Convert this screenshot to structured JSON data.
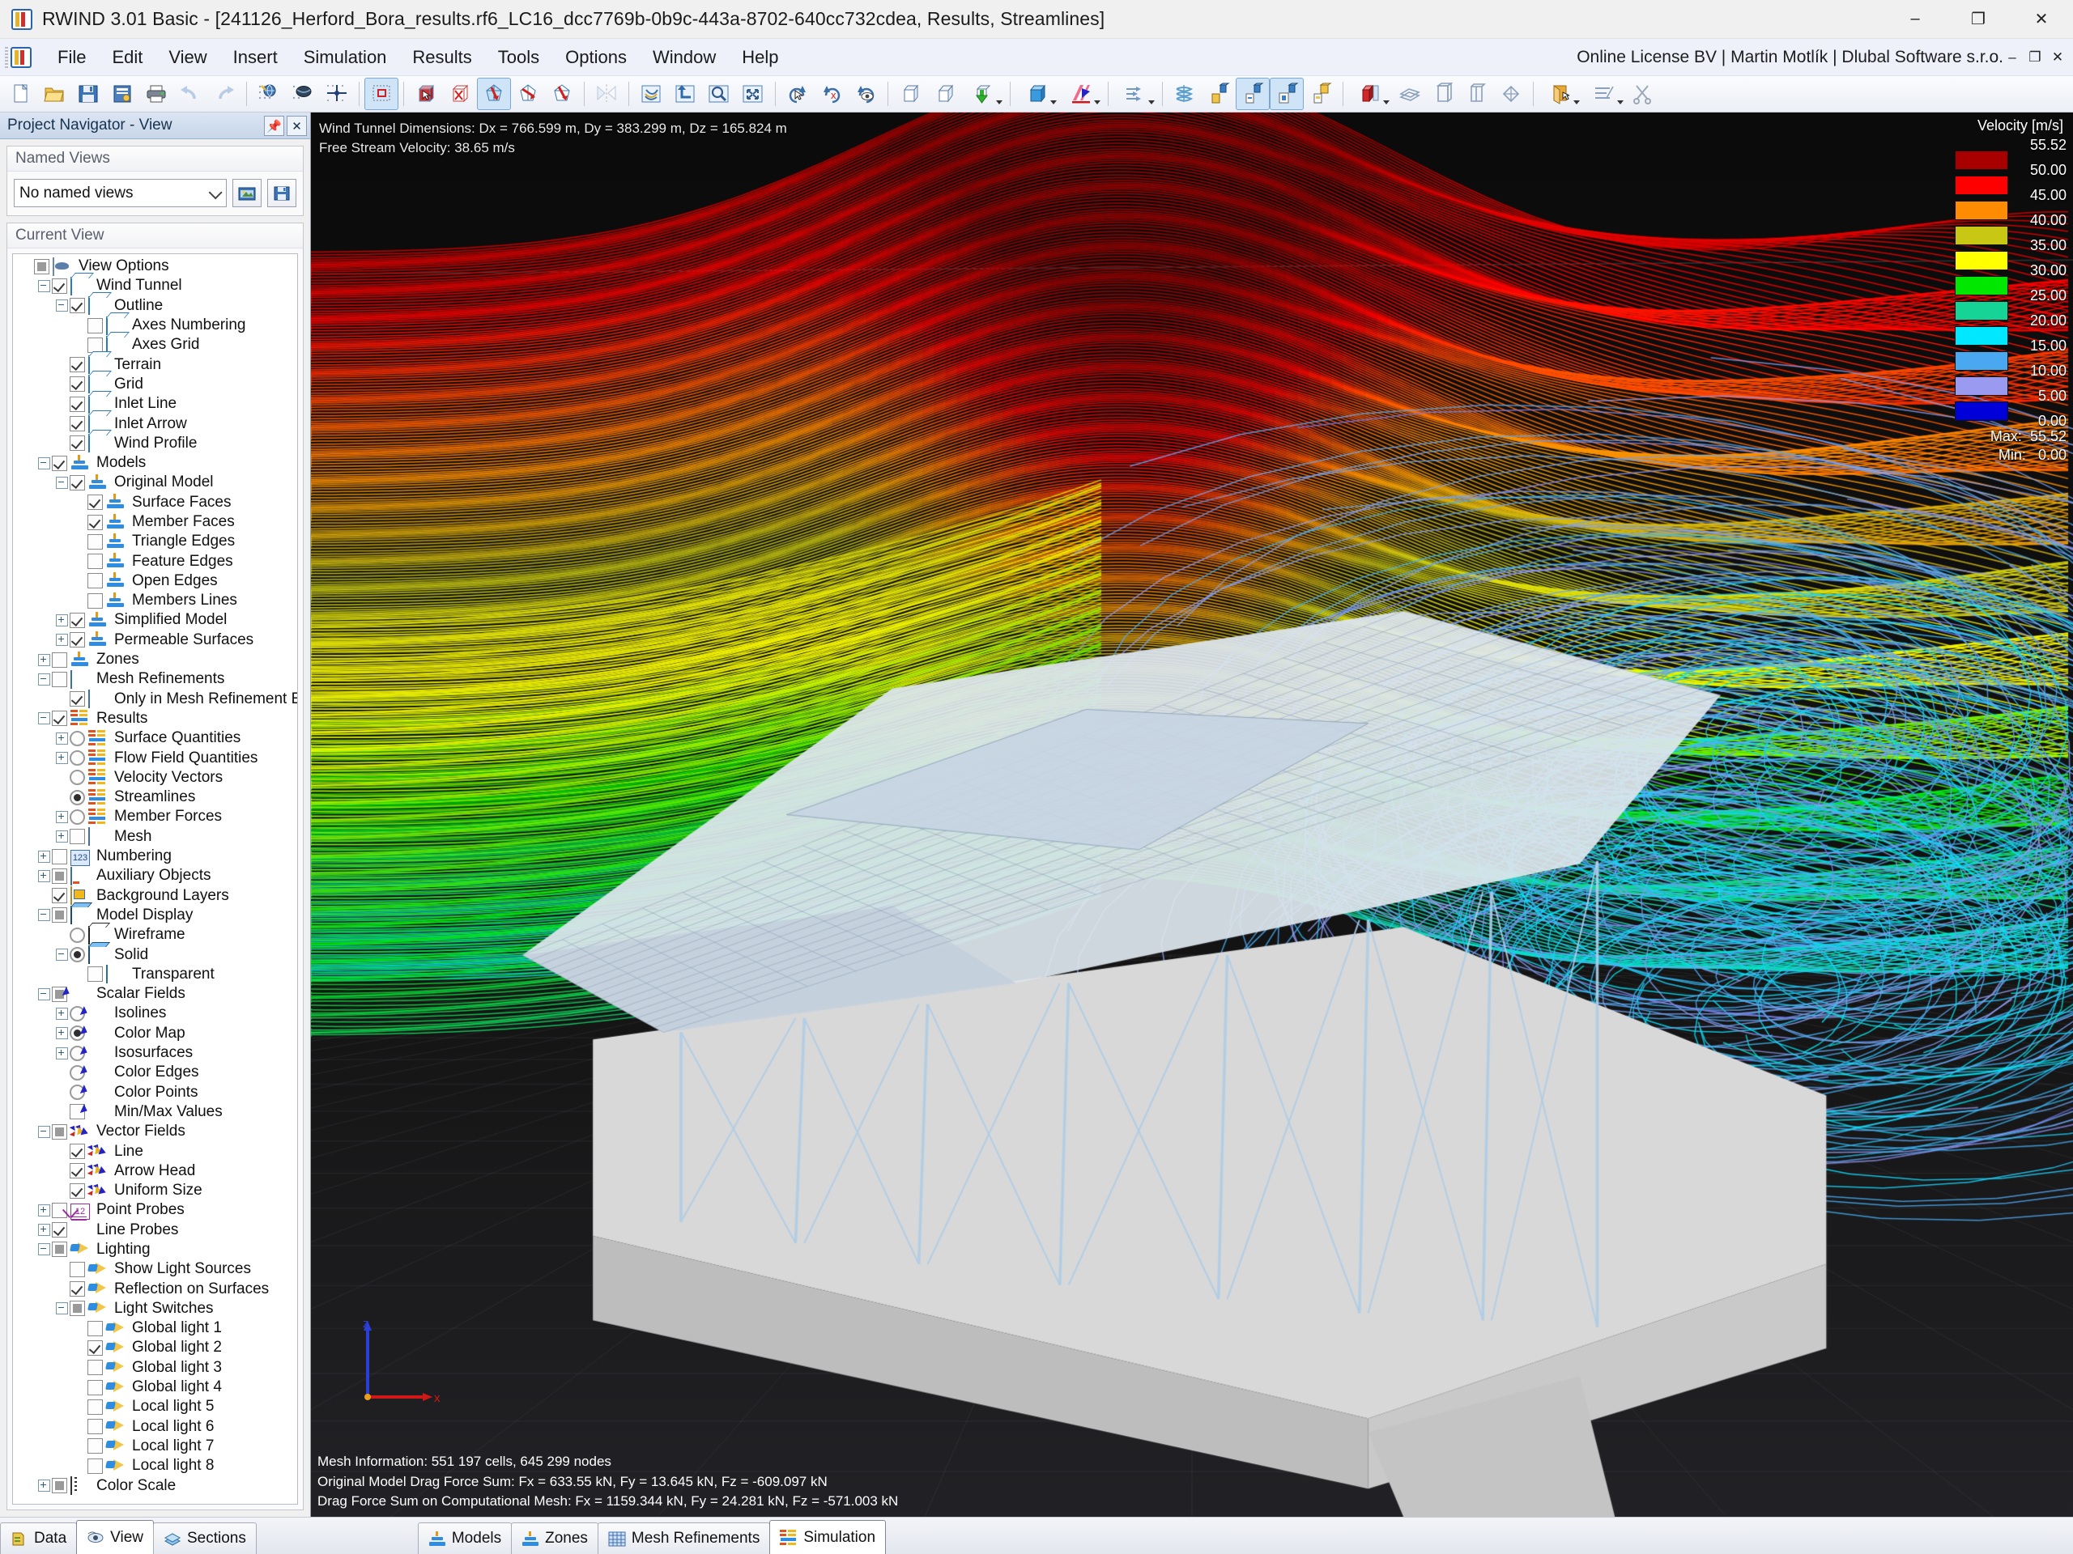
{
  "window": {
    "app_icon": "rwind-icon",
    "title": "RWIND 3.01 Basic - [241126_Herford_Bora_results.rf6_LC16_dcc7769b-0b9c-443a-8702-640cc732cdea, Results, Streamlines]",
    "minimize": "–",
    "maximize": "❐",
    "close": "✕"
  },
  "menubar": {
    "items": [
      "File",
      "Edit",
      "View",
      "Insert",
      "Simulation",
      "Results",
      "Tools",
      "Options",
      "Window",
      "Help"
    ],
    "license": "Online License BV | Martin Motlík | Dlubal Software s.r.o.",
    "mdi_restore": "❐",
    "mdi_close": "✕"
  },
  "toolbar": {
    "buttons": [
      {
        "name": "new-file",
        "icon": "page"
      },
      {
        "name": "open-file",
        "icon": "folder"
      },
      {
        "name": "save-file",
        "icon": "floppy"
      },
      {
        "name": "project-details",
        "icon": "form"
      },
      {
        "name": "print",
        "icon": "printer"
      },
      {
        "name": "undo",
        "icon": "undo",
        "disabled": true
      },
      {
        "name": "redo",
        "icon": "redo",
        "disabled": true
      },
      {
        "name": "render-quality",
        "icon": "dots-globe"
      },
      {
        "name": "visual-settings",
        "icon": "globe-dark"
      },
      {
        "name": "snap-point",
        "icon": "crosshair"
      },
      {
        "name": "selection-box",
        "icon": "dotted-box",
        "active": true
      },
      {
        "name": "select-objects",
        "icon": "cube-arrow"
      },
      {
        "name": "deselect-objects",
        "icon": "cube-x"
      },
      {
        "name": "rotate-view-x",
        "icon": "rot-x",
        "active": true
      },
      {
        "name": "rotate-view-y",
        "icon": "rot-y"
      },
      {
        "name": "rotate-view-z",
        "icon": "rot-z"
      },
      {
        "name": "mirror",
        "icon": "mirror",
        "disabled": true
      },
      {
        "name": "refresh-view",
        "icon": "refresh-blue"
      },
      {
        "name": "previous-view",
        "icon": "back-arrow"
      },
      {
        "name": "zoom-window",
        "icon": "magnifier"
      },
      {
        "name": "zoom-all",
        "icon": "fit-screen"
      },
      {
        "name": "rotate-left",
        "icon": "rot-left"
      },
      {
        "name": "rotate-right",
        "icon": "rot-right"
      },
      {
        "name": "view-rotate-eye",
        "icon": "rot-eye"
      },
      {
        "name": "view-isometric",
        "icon": "cube-iso"
      },
      {
        "name": "view-perspective",
        "icon": "cube-persp"
      },
      {
        "name": "wind-direction",
        "icon": "green-arrow",
        "caret": true
      },
      {
        "name": "model-display",
        "icon": "cube-blue",
        "caret": true
      },
      {
        "name": "scalar-field",
        "icon": "scalar",
        "caret": true
      },
      {
        "name": "streamline-settings",
        "icon": "flow-arrows",
        "caret": true
      },
      {
        "name": "isosurface",
        "icon": "iso-wave"
      },
      {
        "name": "result-diagram-1",
        "icon": "res-1"
      },
      {
        "name": "result-diagram-2",
        "icon": "res-2",
        "active": true
      },
      {
        "name": "result-diagram-3",
        "icon": "res-3",
        "active": true
      },
      {
        "name": "result-diagram-4",
        "icon": "res-4"
      },
      {
        "name": "section-cut",
        "icon": "cut-red",
        "caret": true
      },
      {
        "name": "clip-plane-1",
        "icon": "plane-1"
      },
      {
        "name": "clip-plane-2",
        "icon": "plane-2"
      },
      {
        "name": "clip-plane-3",
        "icon": "plane-3"
      },
      {
        "name": "clip-plane-4",
        "icon": "plane-4"
      },
      {
        "name": "render-mode",
        "icon": "paper-orange",
        "caret": true
      },
      {
        "name": "scissors-settings",
        "icon": "scissors-lines",
        "caret": true
      },
      {
        "name": "scissors",
        "icon": "scissors"
      }
    ]
  },
  "navigator": {
    "title": "Project Navigator - View",
    "pin_icon": "pin-icon",
    "close_icon": "close-icon",
    "named_views": {
      "header": "Named Views",
      "selected": "No named views",
      "open_button_icon": "open-view-icon",
      "save_button_icon": "save-view-icon"
    },
    "current_view": {
      "header": "Current View",
      "tree": [
        {
          "label": "View Options",
          "depth": 0,
          "state": "part",
          "ctl": "check",
          "exp": "none",
          "icon": "view"
        },
        {
          "label": "Wind Tunnel",
          "depth": 1,
          "state": "on",
          "ctl": "check",
          "exp": "minus",
          "icon": "cube"
        },
        {
          "label": "Outline",
          "depth": 2,
          "state": "on",
          "ctl": "check",
          "exp": "minus",
          "icon": "cube"
        },
        {
          "label": "Axes Numbering",
          "depth": 3,
          "state": "off",
          "ctl": "check",
          "exp": "none",
          "icon": "cube"
        },
        {
          "label": "Axes Grid",
          "depth": 3,
          "state": "off",
          "ctl": "check",
          "exp": "none",
          "icon": "cube"
        },
        {
          "label": "Terrain",
          "depth": 2,
          "state": "on",
          "ctl": "check",
          "exp": "none",
          "icon": "cube"
        },
        {
          "label": "Grid",
          "depth": 2,
          "state": "on",
          "ctl": "check",
          "exp": "none",
          "icon": "cube"
        },
        {
          "label": "Inlet Line",
          "depth": 2,
          "state": "on",
          "ctl": "check",
          "exp": "none",
          "icon": "cube"
        },
        {
          "label": "Inlet Arrow",
          "depth": 2,
          "state": "on",
          "ctl": "check",
          "exp": "none",
          "icon": "cube"
        },
        {
          "label": "Wind Profile",
          "depth": 2,
          "state": "on",
          "ctl": "check",
          "exp": "none",
          "icon": "cube"
        },
        {
          "label": "Models",
          "depth": 1,
          "state": "on",
          "ctl": "check",
          "exp": "minus",
          "icon": "model"
        },
        {
          "label": "Original Model",
          "depth": 2,
          "state": "on",
          "ctl": "check",
          "exp": "minus",
          "icon": "model"
        },
        {
          "label": "Surface Faces",
          "depth": 3,
          "state": "on",
          "ctl": "check",
          "exp": "none",
          "icon": "model"
        },
        {
          "label": "Member Faces",
          "depth": 3,
          "state": "on",
          "ctl": "check",
          "exp": "none",
          "icon": "model"
        },
        {
          "label": "Triangle Edges",
          "depth": 3,
          "state": "off",
          "ctl": "check",
          "exp": "none",
          "icon": "model"
        },
        {
          "label": "Feature Edges",
          "depth": 3,
          "state": "off",
          "ctl": "check",
          "exp": "none",
          "icon": "model"
        },
        {
          "label": "Open Edges",
          "depth": 3,
          "state": "off",
          "ctl": "check",
          "exp": "none",
          "icon": "model"
        },
        {
          "label": "Members Lines",
          "depth": 3,
          "state": "off",
          "ctl": "check",
          "exp": "none",
          "icon": "model"
        },
        {
          "label": "Simplified Model",
          "depth": 2,
          "state": "on",
          "ctl": "check",
          "exp": "plus",
          "icon": "model"
        },
        {
          "label": "Permeable Surfaces",
          "depth": 2,
          "state": "on",
          "ctl": "check",
          "exp": "plus",
          "icon": "model"
        },
        {
          "label": "Zones",
          "depth": 1,
          "state": "off",
          "ctl": "check",
          "exp": "plus",
          "icon": "model-or"
        },
        {
          "label": "Mesh Refinements",
          "depth": 1,
          "state": "off",
          "ctl": "check",
          "exp": "minus",
          "icon": "grid"
        },
        {
          "label": "Only in Mesh Refinement Editor",
          "depth": 2,
          "state": "on",
          "ctl": "check",
          "exp": "none",
          "icon": "grid"
        },
        {
          "label": "Results",
          "depth": 1,
          "state": "on",
          "ctl": "check",
          "exp": "minus",
          "icon": "res"
        },
        {
          "label": "Surface Quantities",
          "depth": 2,
          "state": "off",
          "ctl": "radio",
          "exp": "plus",
          "icon": "res"
        },
        {
          "label": "Flow Field Quantities",
          "depth": 2,
          "state": "off",
          "ctl": "radio",
          "exp": "plus",
          "icon": "res"
        },
        {
          "label": "Velocity Vectors",
          "depth": 2,
          "state": "off",
          "ctl": "radio",
          "exp": "none",
          "icon": "res"
        },
        {
          "label": "Streamlines",
          "depth": 2,
          "state": "on",
          "ctl": "radio",
          "exp": "none",
          "icon": "res"
        },
        {
          "label": "Member Forces",
          "depth": 2,
          "state": "off",
          "ctl": "radio",
          "exp": "plus",
          "icon": "res"
        },
        {
          "label": "Mesh",
          "depth": 2,
          "state": "off",
          "ctl": "check",
          "exp": "plus",
          "icon": "grid"
        },
        {
          "label": "Numbering",
          "depth": 1,
          "state": "off",
          "ctl": "check",
          "exp": "plus",
          "icon": "num"
        },
        {
          "label": "Auxiliary Objects",
          "depth": 1,
          "state": "part",
          "ctl": "check",
          "exp": "plus",
          "icon": "aux"
        },
        {
          "label": "Background Layers",
          "depth": 1,
          "state": "on",
          "ctl": "check",
          "exp": "none",
          "icon": "bg"
        },
        {
          "label": "Model Display",
          "depth": 1,
          "state": "part",
          "ctl": "check",
          "exp": "minus",
          "icon": "solid"
        },
        {
          "label": "Wireframe",
          "depth": 2,
          "state": "off",
          "ctl": "radio",
          "exp": "none",
          "icon": "wire"
        },
        {
          "label": "Solid",
          "depth": 2,
          "state": "on",
          "ctl": "radio",
          "exp": "minus",
          "icon": "solid"
        },
        {
          "label": "Transparent",
          "depth": 3,
          "state": "off",
          "ctl": "check",
          "exp": "none",
          "icon": "trans"
        },
        {
          "label": "Scalar Fields",
          "depth": 1,
          "state": "part",
          "ctl": "check",
          "exp": "minus",
          "icon": "scal"
        },
        {
          "label": "Isolines",
          "depth": 2,
          "state": "off",
          "ctl": "radio",
          "exp": "plus",
          "icon": "scal"
        },
        {
          "label": "Color Map",
          "depth": 2,
          "state": "on",
          "ctl": "radio",
          "exp": "plus",
          "icon": "scal"
        },
        {
          "label": "Isosurfaces",
          "depth": 2,
          "state": "off",
          "ctl": "radio",
          "exp": "plus",
          "icon": "scal"
        },
        {
          "label": "Color Edges",
          "depth": 2,
          "state": "off",
          "ctl": "radio",
          "exp": "none",
          "icon": "scal"
        },
        {
          "label": "Color Points",
          "depth": 2,
          "state": "off",
          "ctl": "radio",
          "exp": "none",
          "icon": "scal"
        },
        {
          "label": "Min/Max Values",
          "depth": 2,
          "state": "off",
          "ctl": "check",
          "exp": "none",
          "icon": "scal"
        },
        {
          "label": "Vector Fields",
          "depth": 1,
          "state": "part",
          "ctl": "check",
          "exp": "minus",
          "icon": "vec"
        },
        {
          "label": "Line",
          "depth": 2,
          "state": "on",
          "ctl": "check",
          "exp": "none",
          "icon": "vec"
        },
        {
          "label": "Arrow Head",
          "depth": 2,
          "state": "on",
          "ctl": "check",
          "exp": "none",
          "icon": "vec"
        },
        {
          "label": "Uniform Size",
          "depth": 2,
          "state": "on",
          "ctl": "check",
          "exp": "none",
          "icon": "vec"
        },
        {
          "label": "Point Probes",
          "depth": 1,
          "state": "off",
          "ctl": "check",
          "exp": "plus",
          "icon": "probe"
        },
        {
          "label": "Line Probes",
          "depth": 1,
          "state": "on",
          "ctl": "check",
          "exp": "plus",
          "icon": "lprobe"
        },
        {
          "label": "Lighting",
          "depth": 1,
          "state": "part",
          "ctl": "check",
          "exp": "minus",
          "icon": "light"
        },
        {
          "label": "Show Light Sources",
          "depth": 2,
          "state": "off",
          "ctl": "check",
          "exp": "none",
          "icon": "light"
        },
        {
          "label": "Reflection on Surfaces",
          "depth": 2,
          "state": "on",
          "ctl": "check",
          "exp": "none",
          "icon": "light"
        },
        {
          "label": "Light Switches",
          "depth": 2,
          "state": "part",
          "ctl": "check",
          "exp": "minus",
          "icon": "light"
        },
        {
          "label": "Global light 1",
          "depth": 3,
          "state": "off",
          "ctl": "check",
          "exp": "none",
          "icon": "light"
        },
        {
          "label": "Global light 2",
          "depth": 3,
          "state": "on",
          "ctl": "check",
          "exp": "none",
          "icon": "light"
        },
        {
          "label": "Global light 3",
          "depth": 3,
          "state": "off",
          "ctl": "check",
          "exp": "none",
          "icon": "light"
        },
        {
          "label": "Global light 4",
          "depth": 3,
          "state": "off",
          "ctl": "check",
          "exp": "none",
          "icon": "light"
        },
        {
          "label": "Local light 5",
          "depth": 3,
          "state": "off",
          "ctl": "check",
          "exp": "none",
          "icon": "light"
        },
        {
          "label": "Local light 6",
          "depth": 3,
          "state": "off",
          "ctl": "check",
          "exp": "none",
          "icon": "light"
        },
        {
          "label": "Local light 7",
          "depth": 3,
          "state": "off",
          "ctl": "check",
          "exp": "none",
          "icon": "light"
        },
        {
          "label": "Local light 8",
          "depth": 3,
          "state": "off",
          "ctl": "check",
          "exp": "none",
          "icon": "light"
        },
        {
          "label": "Color Scale",
          "depth": 1,
          "state": "part",
          "ctl": "check",
          "exp": "plus",
          "icon": "cs"
        }
      ]
    }
  },
  "viewport": {
    "info_line_1": "Wind Tunnel Dimensions: Dx = 766.599 m, Dy = 383.299 m, Dz = 165.824 m",
    "info_line_2": "Free Stream Velocity: 38.65 m/s",
    "mesh_info": "Mesh Information: 551 197 cells, 645 299 nodes",
    "drag_original": "Original Model Drag Force Sum: Fx = 633.55 kN, Fy = 13.645 kN, Fz = -609.097 kN",
    "drag_mesh": "Drag Force Sum on Computational Mesh: Fx = 1159.344 kN, Fy = 24.281 kN, Fz = -571.003 kN",
    "axis_z_label": "z",
    "axis_x_label": "x"
  },
  "legend": {
    "title": "Velocity [m/s]",
    "ticks": [
      "55.52",
      "50.00",
      "45.00",
      "40.00",
      "35.00",
      "30.00",
      "25.00",
      "20.00",
      "15.00",
      "10.00",
      "5.00",
      "0.00"
    ],
    "colors": [
      "#a80000",
      "#ff0000",
      "#ff8c00",
      "#c8c814",
      "#ffff00",
      "#00e800",
      "#16d496",
      "#00e8ff",
      "#4aa8f0",
      "#9a9af0",
      "#0000d8"
    ],
    "max_label": "Max:",
    "max_value": "55.52",
    "min_label": "Min:",
    "min_value": "0.00"
  },
  "bottom_tabs": {
    "left": [
      {
        "label": "Data",
        "icon": "data-icon",
        "selected": false
      },
      {
        "label": "View",
        "icon": "view-icon",
        "selected": true
      },
      {
        "label": "Sections",
        "icon": "sections-icon",
        "selected": false
      }
    ],
    "right": [
      {
        "label": "Models",
        "icon": "models-icon",
        "selected": false
      },
      {
        "label": "Zones",
        "icon": "zones-icon",
        "selected": false
      },
      {
        "label": "Mesh Refinements",
        "icon": "mesh-icon",
        "selected": false
      },
      {
        "label": "Simulation",
        "icon": "simulation-icon",
        "selected": true
      }
    ]
  }
}
